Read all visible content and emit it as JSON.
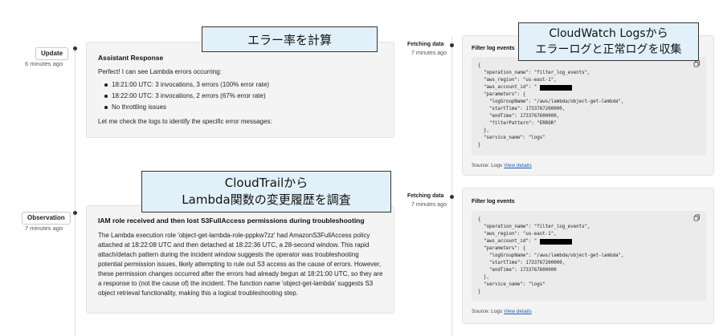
{
  "left": {
    "update": {
      "badge": "Update",
      "time": "6 minutes ago",
      "card": {
        "title": "Assistant Response",
        "intro": "Perfect! I can see Lambda errors occurring:",
        "bullets": [
          "18:21:00 UTC: 3 invocations, 3 errors (100% error rate)",
          "18:22:00 UTC: 3 invocations, 2 errors (67% error rate)",
          "No throttling issues"
        ],
        "closing": "Let me check the logs to identify the specific error messages:"
      },
      "callout": "エラー率を計算"
    },
    "observation": {
      "badge": "Observation",
      "time": "7 minutes ago",
      "card": {
        "title": "IAM role received and then lost S3FullAccess permissions during troubleshooting",
        "body_lines": [
          "The Lambda execution role 'object-get-lambda-role-pppkw7zz' had AmazonS3FullAccess policy",
          "attached at 18:22:08 UTC and then detached at 18:22:36 UTC, a 28-second window. This rapid",
          "attach/detach pattern during the incident window suggests the operator was troubleshooting",
          "potential permission issues, likely attempting to rule out S3 access as the cause of errors. However,",
          "these permission changes occurred after the errors had already begun at 18:21:00 UTC, so they are",
          "a response to (not the cause of) the incident. The function name 'object-get-lambda' suggests S3",
          "object retrieval functionality, making this a logical troubleshooting step."
        ]
      },
      "callout_lines": [
        "CloudTrailから",
        "Lambda関数の変更履歴を調査"
      ]
    }
  },
  "right": {
    "callout_lines": [
      "CloudWatch Logsから",
      "エラーログと正常ログを収集"
    ],
    "entries": [
      {
        "badge": "Fetching data",
        "time": "7 minutes ago",
        "title": "Filter log events",
        "code_lines": [
          "{",
          "  \"operation_name\": \"filter_log_events\",",
          "  \"aws_region\": \"us-east-1\",",
          "  \"aws_account_id\": \"",
          "  \"parameters\": {",
          "    \"logGroupName\": \"/aws/lambda/object-get-lambda\",",
          "    \"startTime\": 1733767200000,",
          "    \"endTime\": 1733767600000,",
          "    \"filterPattern\": \"ERROR\"",
          "  },",
          "  \"service_name\": \"logs\"",
          "}"
        ],
        "source_label": "Source: Logs",
        "source_link": "View details"
      },
      {
        "badge": "Fetching data",
        "time": "7 minutes ago",
        "title": "Filter log events",
        "code_lines": [
          "{",
          "  \"operation_name\": \"filter_log_events\",",
          "  \"aws_region\": \"us-east-1\",",
          "  \"aws_account_id\": \"",
          "  \"parameters\": {",
          "    \"logGroupName\": \"/aws/lambda/object-get-lambda\",",
          "    \"startTime\": 1733767200000,",
          "    \"endTime\": 1733767600000",
          "  },",
          "  \"service_name\": \"logs\"",
          "}"
        ],
        "source_label": "Source: Logs",
        "source_link": "View details"
      }
    ]
  }
}
